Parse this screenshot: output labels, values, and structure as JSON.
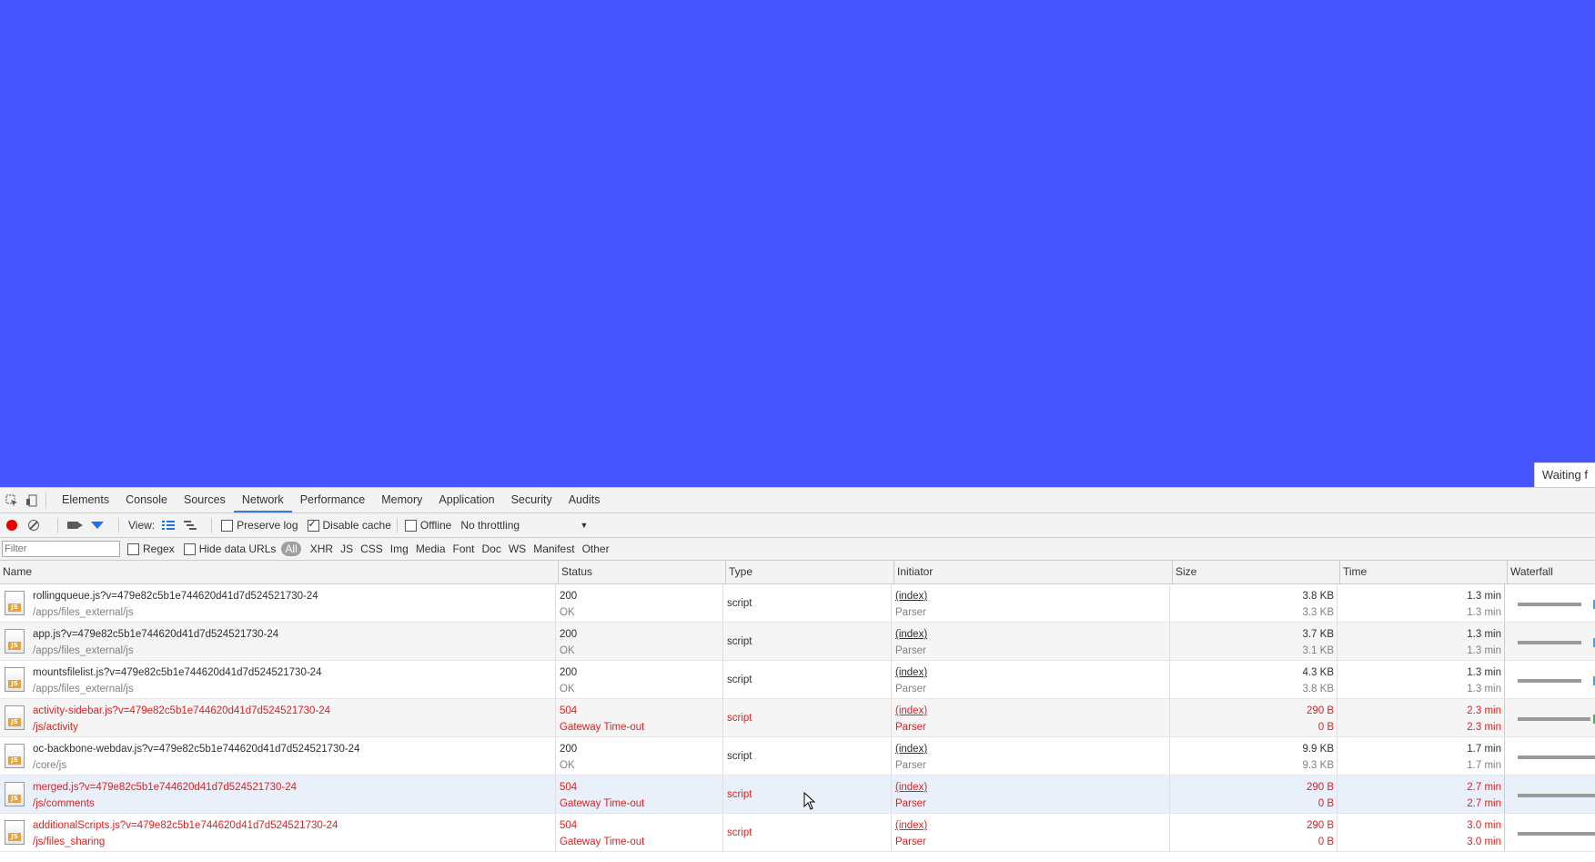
{
  "page": {
    "waiting_text": "Waiting f"
  },
  "tabs": [
    "Elements",
    "Console",
    "Sources",
    "Network",
    "Performance",
    "Memory",
    "Application",
    "Security",
    "Audits"
  ],
  "active_tab": "Network",
  "toolbar": {
    "view_label": "View:",
    "preserve_log": "Preserve log",
    "disable_cache": "Disable cache",
    "offline": "Offline",
    "throttling": "No throttling"
  },
  "filterbar": {
    "placeholder": "Filter",
    "regex": "Regex",
    "hide_data_urls": "Hide data URLs",
    "types": [
      "All",
      "XHR",
      "JS",
      "CSS",
      "Img",
      "Media",
      "Font",
      "Doc",
      "WS",
      "Manifest",
      "Other"
    ]
  },
  "columns": {
    "name": "Name",
    "status": "Status",
    "type": "Type",
    "initiator": "Initiator",
    "size": "Size",
    "time": "Time",
    "waterfall": "Waterfall"
  },
  "rows": [
    {
      "name": "rollingqueue.js?v=479e82c5b1e744620d41d7d524521730-24",
      "path": "/apps/files_external/js",
      "status": "200",
      "status_text": "OK",
      "type": "script",
      "initiator": "(index)",
      "initiator_sub": "Parser",
      "size": "3.8 KB",
      "size_sub": "3.3 KB",
      "time": "1.3 min",
      "time_sub": "1.3 min",
      "error": false
    },
    {
      "name": "app.js?v=479e82c5b1e744620d41d7d524521730-24",
      "path": "/apps/files_external/js",
      "status": "200",
      "status_text": "OK",
      "type": "script",
      "initiator": "(index)",
      "initiator_sub": "Parser",
      "size": "3.7 KB",
      "size_sub": "3.1 KB",
      "time": "1.3 min",
      "time_sub": "1.3 min",
      "error": false
    },
    {
      "name": "mountsfilelist.js?v=479e82c5b1e744620d41d7d524521730-24",
      "path": "/apps/files_external/js",
      "status": "200",
      "status_text": "OK",
      "type": "script",
      "initiator": "(index)",
      "initiator_sub": "Parser",
      "size": "4.3 KB",
      "size_sub": "3.8 KB",
      "time": "1.3 min",
      "time_sub": "1.3 min",
      "error": false
    },
    {
      "name": "activity-sidebar.js?v=479e82c5b1e744620d41d7d524521730-24",
      "path": "/js/activity",
      "status": "504",
      "status_text": "Gateway Time-out",
      "type": "script",
      "initiator": "(index)",
      "initiator_sub": "Parser",
      "size": "290 B",
      "size_sub": "0 B",
      "time": "2.3 min",
      "time_sub": "2.3 min",
      "error": true
    },
    {
      "name": "oc-backbone-webdav.js?v=479e82c5b1e744620d41d7d524521730-24",
      "path": "/core/js",
      "status": "200",
      "status_text": "OK",
      "type": "script",
      "initiator": "(index)",
      "initiator_sub": "Parser",
      "size": "9.9 KB",
      "size_sub": "9.3 KB",
      "time": "1.7 min",
      "time_sub": "1.7 min",
      "error": false
    },
    {
      "name": "merged.js?v=479e82c5b1e744620d41d7d524521730-24",
      "path": "/js/comments",
      "status": "504",
      "status_text": "Gateway Time-out",
      "type": "script",
      "initiator": "(index)",
      "initiator_sub": "Parser",
      "size": "290 B",
      "size_sub": "0 B",
      "time": "2.7 min",
      "time_sub": "2.7 min",
      "error": true
    },
    {
      "name": "additionalScripts.js?v=479e82c5b1e744620d41d7d524521730-24",
      "path": "/js/files_sharing",
      "status": "504",
      "status_text": "Gateway Time-out",
      "type": "script",
      "initiator": "(index)",
      "initiator_sub": "Parser",
      "size": "290 B",
      "size_sub": "0 B",
      "time": "3.0 min",
      "time_sub": "3.0 min",
      "error": true
    }
  ]
}
